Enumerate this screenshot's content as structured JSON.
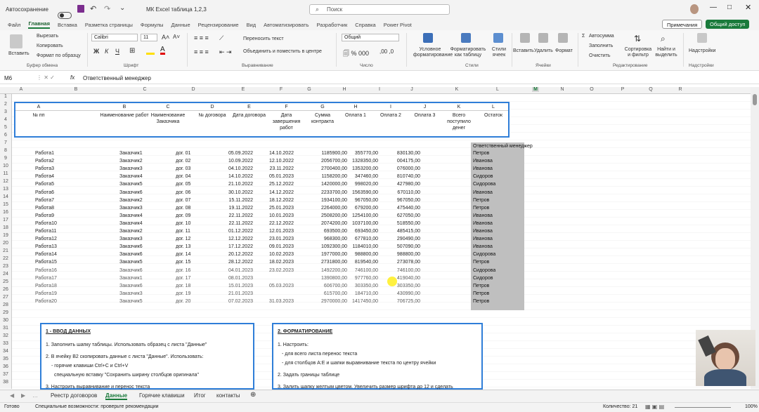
{
  "titlebar": {
    "autosave": "Автосохранение",
    "filename": "МК Excel таблица 1,2,3",
    "search": "Поиск"
  },
  "menu": [
    "Файл",
    "Главная",
    "Вставка",
    "Разметка страницы",
    "Формулы",
    "Данные",
    "Рецензирование",
    "Вид",
    "Автоматизировать",
    "Разработчик",
    "Справка",
    "Power Pivot"
  ],
  "menu_active": "Главная",
  "menu_right": {
    "notes": "Примечания",
    "share": "Общий доступ"
  },
  "ribbon": {
    "paste": "Вставить",
    "cut": "Вырезать",
    "copy": "Копировать",
    "format_painter": "Формат по образцу",
    "font": "Calibri",
    "font_size": "11",
    "wrap": "Переносить текст",
    "merge": "Объединить и поместить в центре",
    "numfmt": "Общий",
    "cond": "Условное форматирование",
    "as_table": "Форматировать как таблицу",
    "styles": "Стили ячеек",
    "insert": "Вставить",
    "delete": "Удалить",
    "format": "Формат",
    "autosum": "Автосумма",
    "fill": "Заполнить",
    "clear": "Очистить",
    "sort": "Сортировка и фильтр",
    "find": "Найти и выделить",
    "addins": "Надстройки",
    "groups": [
      "Буфер обмена",
      "Шрифт",
      "Выравнивание",
      "Число",
      "Стили",
      "Ячейки",
      "Редактирование",
      "Надстройки"
    ]
  },
  "formula": {
    "cell": "M6",
    "fx": "fx",
    "value": "Ответственный менеджер"
  },
  "columns": [
    "A",
    "B",
    "C",
    "D",
    "E",
    "F",
    "G",
    "H",
    "I",
    "J",
    "K",
    "L",
    "M",
    "N",
    "O",
    "P",
    "Q",
    "R"
  ],
  "hdr_letters": [
    "A",
    "B",
    "C",
    "D",
    "E",
    "F",
    "G",
    "H",
    "I",
    "J",
    "K",
    "L"
  ],
  "hdr_titles": [
    "№ пп",
    "Наименование работ",
    "Наименование Заказчика",
    "№ договора",
    "Дата договора",
    "Дата завершения работ",
    "Сумма контракта",
    "Оплата 1",
    "Оплата 2",
    "Оплата 3",
    "Всего поступило денег",
    "Остаток"
  ],
  "rows": [
    [
      "Работа1",
      "Заказчик1",
      "дог. 01",
      "05.09.2022",
      "14.10.2022",
      "1185900,00",
      "355770,00",
      "830130,00",
      "Петров"
    ],
    [
      "Работа2",
      "Заказчик2",
      "дог. 02",
      "10.09.2022",
      "12.10.2022",
      "2056700,00",
      "1328350,00",
      "004175,00",
      "Иванова"
    ],
    [
      "Работа3",
      "Заказчик3",
      "дог. 03",
      "04.10.2022",
      "23.11.2022",
      "2700400,00",
      "1353200,00",
      "076000,00",
      "Иванова"
    ],
    [
      "Работа4",
      "Заказчик4",
      "дог. 04",
      "14.10.2022",
      "05.01.2023",
      "1158200,00",
      "347460,00",
      "810740,00",
      "Сидоров"
    ],
    [
      "Работа5",
      "Заказчик5",
      "дог. 05",
      "21.10.2022",
      "25.12.2022",
      "1420000,00",
      "998020,00",
      "427980,00",
      "Сидорова"
    ],
    [
      "Работа6",
      "Заказчик6",
      "дог. 06",
      "30.10.2022",
      "14.12.2022",
      "2233700,00",
      "1563590,00",
      "670110,00",
      "Иванова"
    ],
    [
      "Работа7",
      "Заказчик2",
      "дог. 07",
      "15.11.2022",
      "18.12.2022",
      "1934100,00",
      "967050,00",
      "967050,00",
      "Петров"
    ],
    [
      "Работа8",
      "Заказчик3",
      "дог. 08",
      "19.11.2022",
      "25.01.2023",
      "2264000,00",
      "679200,00",
      "475440,00",
      "Петров"
    ],
    [
      "Работа9",
      "Заказчик4",
      "дог. 09",
      "22.11.2022",
      "10.01.2023",
      "2508200,00",
      "1254100,00",
      "627050,00",
      "Иванова"
    ],
    [
      "Работа10",
      "Заказчик4",
      "дог. 10",
      "22.11.2022",
      "22.12.2022",
      "2074200,00",
      "1037100,00",
      "518550,00",
      "Иванова"
    ],
    [
      "Работа11",
      "Заказчик2",
      "дог. 11",
      "01.12.2022",
      "12.01.2023",
      "693500,00",
      "693450,00",
      "485415,00",
      "Иванова"
    ],
    [
      "Работа12",
      "Заказчик3",
      "дог. 12",
      "12.12.2022",
      "23.01.2023",
      "968300,00",
      "677810,00",
      "290490,00",
      "Иванова"
    ],
    [
      "Работа13",
      "Заказчик6",
      "дог. 13",
      "17.12.2022",
      "09.01.2023",
      "1092300,00",
      "1184010,00",
      "507090,00",
      "Иванова"
    ],
    [
      "Работа14",
      "Заказчик6",
      "дог. 14",
      "20.12.2022",
      "10.02.2023",
      "1977000,00",
      "988800,00",
      "988800,00",
      "Сидорова"
    ],
    [
      "Работа15",
      "Заказчик5",
      "дог. 15",
      "28.12.2022",
      "18.02.2023",
      "2731800,00",
      "819540,00",
      "273078,00",
      "Петров"
    ],
    [
      "Работа16",
      "Заказчик6",
      "дог. 16",
      "04.01.2023",
      "23.02.2023",
      "1492200,00",
      "746100,00",
      "746100,00",
      "Сидорова"
    ],
    [
      "Работа17",
      "Заказчик1",
      "дог. 17",
      "08.01.2023",
      "",
      "1390800,00",
      "977760,00",
      "419040,00",
      "Сидоров"
    ],
    [
      "Работа18",
      "Заказчик6",
      "дог. 18",
      "15.01.2023",
      "05.03.2023",
      "606700,00",
      "303350,00",
      "303350,00",
      "Петров"
    ],
    [
      "Работа19",
      "Заказчик3",
      "дог. 19",
      "21.01.2023",
      "",
      "615700,00",
      "184710,00",
      "430990,00",
      "Петров"
    ],
    [
      "Работа20",
      "Заказчик5",
      "дог. 20",
      "07.02.2023",
      "31.03.2023",
      "2970000,00",
      "1417450,00",
      "706725,00",
      "Петров"
    ]
  ],
  "resp_header": "Ответственный менеджер",
  "extra_resp": [
    "Сидоров",
    "Сидоров"
  ],
  "panel1": {
    "title": "1 - ВВОД ДАННЫХ",
    "lines": [
      "1. Заполнить шапку таблицы. Использовать образец с листа \"Данные\"",
      "2. В ячейку B2 скопировать данные с листа \"Данные\". Использовать:",
      "- горячие клавиши Ctrl+C и Ctrl+V",
      "специальную вставку \"Сохранить ширину столбцов оригинала\"",
      "3. Настроить выравнивание и перенос текста"
    ]
  },
  "panel2": {
    "title": "2. ФОРМАТИРОВАНИЕ",
    "lines": [
      "1. Настроить:",
      "- для всего листа перенос текста",
      "- для столбцов A:E и шапки выравнивание текста по центру ячейки",
      "2. Задать границы таблице",
      "3. Залить шапку желтым цветом. Увеличить размер шрифта до 12 и сделать"
    ]
  },
  "sheets": [
    "Реестр договоров",
    "Данные",
    "Горячие клавиши",
    "Итог",
    "контакты"
  ],
  "active_sheet": "Данные",
  "status": {
    "ready": "Готово",
    "access": "Специальные возможности: проверьте рекомендации",
    "count": "Количество: 21",
    "zoom": "100%"
  }
}
